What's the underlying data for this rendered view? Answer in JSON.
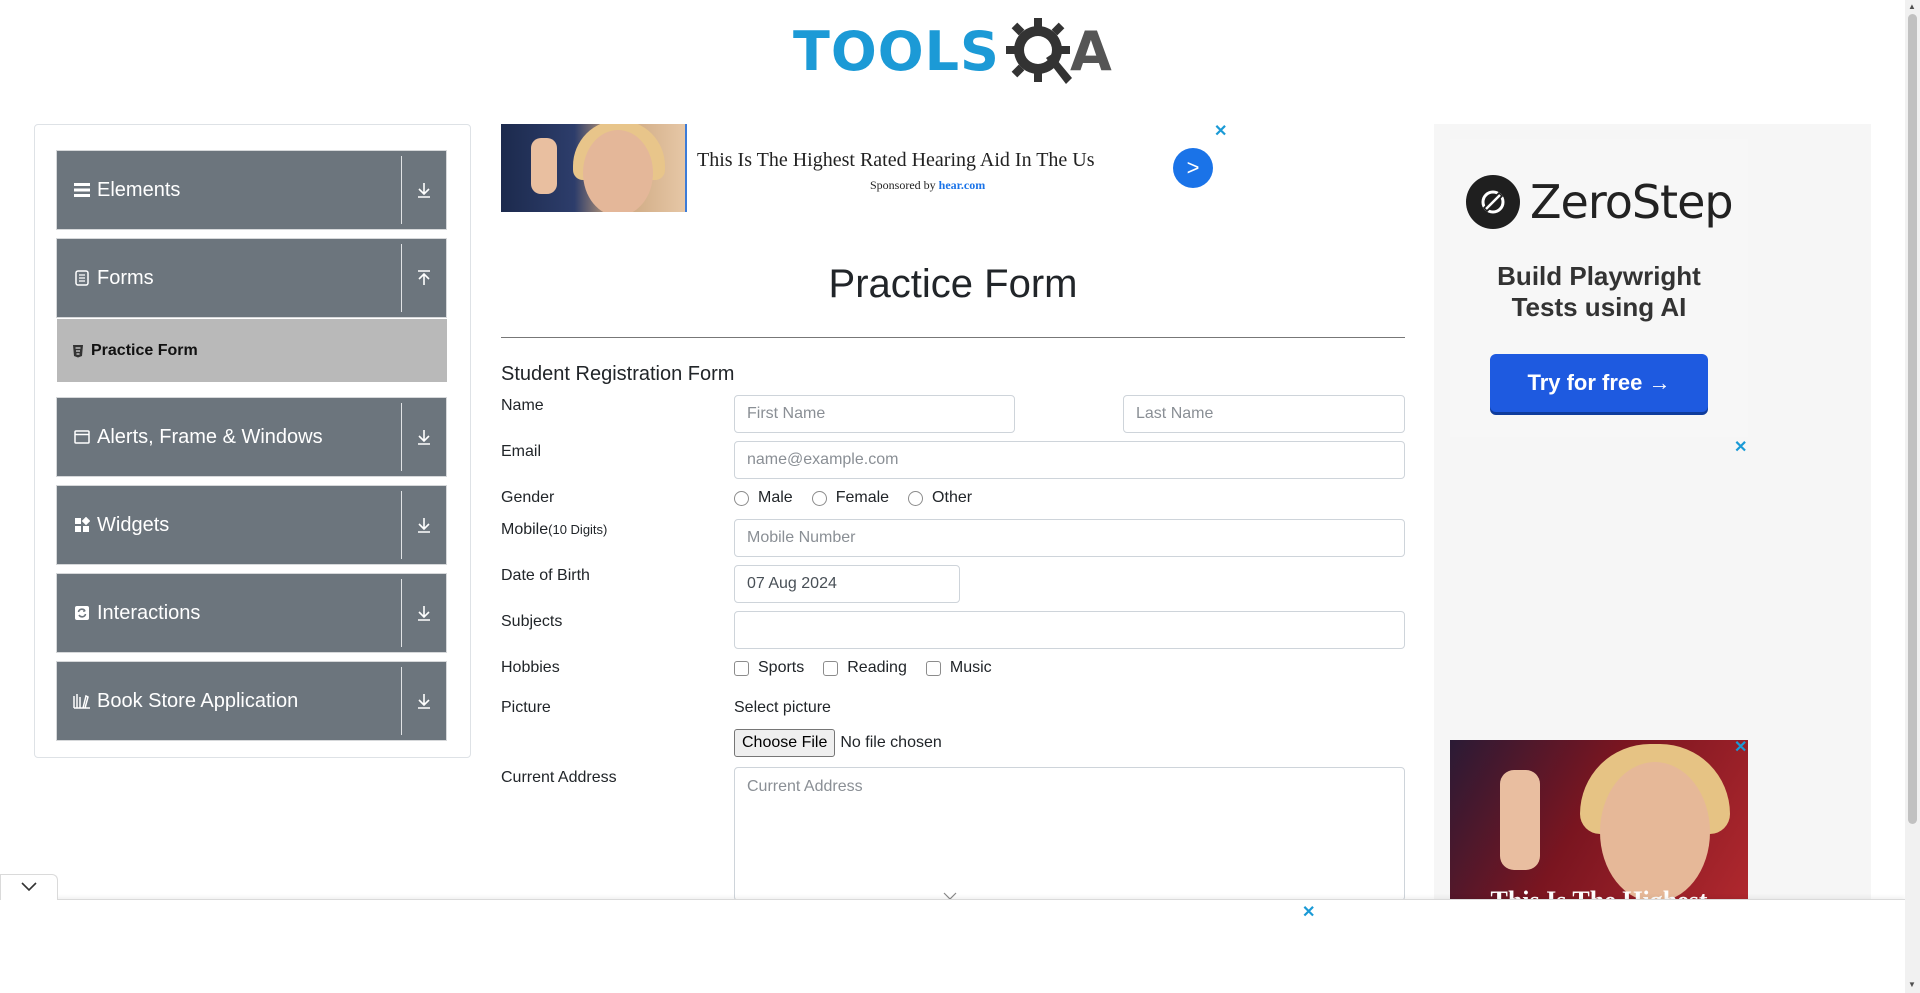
{
  "header": {
    "logo_text": "TOOLS",
    "logo_suffix": "A",
    "logo_alt": "TOOLSQA"
  },
  "sidebar": {
    "groups": [
      {
        "label": "Elements",
        "icon": "menu-icon",
        "arrow": "download-arrow"
      },
      {
        "label": "Forms",
        "icon": "document-icon",
        "arrow": "upload-arrow"
      },
      {
        "label": "Alerts, Frame & Windows",
        "icon": "window-icon",
        "arrow": "download-arrow"
      },
      {
        "label": "Widgets",
        "icon": "grid-icon",
        "arrow": "download-arrow"
      },
      {
        "label": "Interactions",
        "icon": "refresh-icon",
        "arrow": "download-arrow"
      },
      {
        "label": "Book Store Application",
        "icon": "books-icon",
        "arrow": "download-arrow"
      }
    ],
    "active_item": {
      "label": "Practice Form",
      "icon": "html-icon"
    }
  },
  "ad_top": {
    "headline": "This Is The Highest Rated Hearing Aid In The Us",
    "sponsor_prefix": "Sponsored by",
    "sponsor_name": "hear.com",
    "go_label": ">"
  },
  "main": {
    "page_title": "Practice Form",
    "form_title": "Student Registration Form",
    "labels": {
      "name": "Name",
      "email": "Email",
      "gender": "Gender",
      "mobile": "Mobile",
      "mobile_hint": "(10 Digits)",
      "dob": "Date of Birth",
      "subjects": "Subjects",
      "hobbies": "Hobbies",
      "picture": "Picture",
      "current_address": "Current Address"
    },
    "placeholders": {
      "first_name": "First Name",
      "last_name": "Last Name",
      "email": "name@example.com",
      "mobile": "Mobile Number",
      "current_address": "Current Address"
    },
    "dob_value": "07 Aug 2024",
    "subjects_value": "",
    "gender_options": [
      "Male",
      "Female",
      "Other"
    ],
    "hobby_options": [
      "Sports",
      "Reading",
      "Music"
    ],
    "select_picture_label": "Select picture",
    "file_button": "Choose File",
    "file_status": "No file chosen"
  },
  "ad_right": {
    "brand": "ZeroStep",
    "tagline_line1": "Build Playwright",
    "tagline_line2": "Tests using AI",
    "cta": "Try for free →",
    "bottom_ad_text": "This Is The Highest"
  },
  "colors": {
    "sidebar_group": "#6c757d",
    "sidebar_active": "#b9b9b9",
    "accent_blue": "#1a73e8",
    "logo_blue": "#1c9ad6",
    "zerostep_button": "#1e5ae0"
  }
}
